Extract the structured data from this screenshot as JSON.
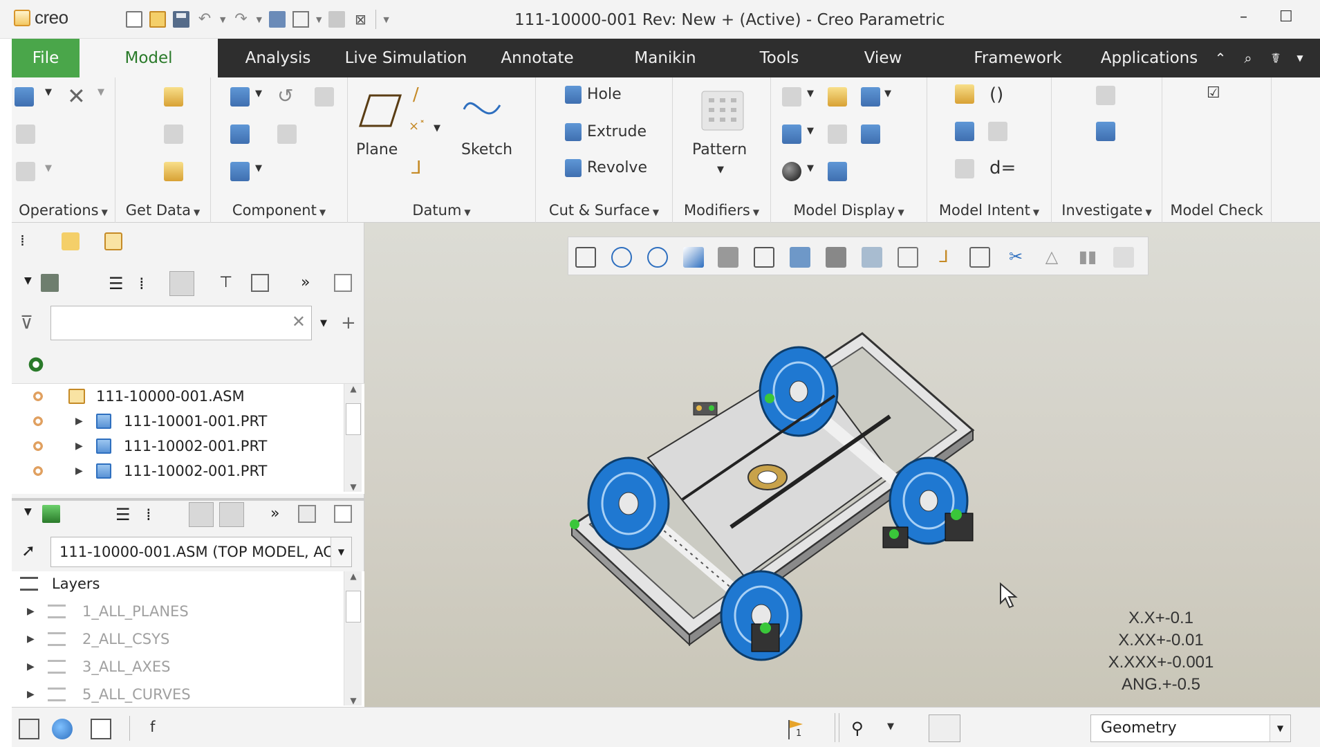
{
  "app": {
    "logo_text": "creo",
    "window_title": "111-10000-001 Rev: New + (Active) - Creo Parametric"
  },
  "tabs": [
    {
      "label": "File"
    },
    {
      "label": "Model"
    },
    {
      "label": "Analysis"
    },
    {
      "label": "Live Simulation"
    },
    {
      "label": "Annotate"
    },
    {
      "label": "Manikin"
    },
    {
      "label": "Tools"
    },
    {
      "label": "View"
    },
    {
      "label": "Framework"
    },
    {
      "label": "Applications"
    }
  ],
  "ribbon": {
    "groups": [
      {
        "label": "Operations"
      },
      {
        "label": "Get Data"
      },
      {
        "label": "Component"
      },
      {
        "label": "Datum"
      },
      {
        "label": "Cut & Surface"
      },
      {
        "label": "Modifiers"
      },
      {
        "label": "Model Display"
      },
      {
        "label": "Model Intent"
      },
      {
        "label": "Investigate"
      },
      {
        "label": "Model Check"
      }
    ],
    "buttons": {
      "plane": "Plane",
      "sketch": "Sketch",
      "hole": "Hole",
      "extrude": "Extrude",
      "revolve": "Revolve",
      "pattern": "Pattern",
      "relations": "d="
    }
  },
  "model_tree": {
    "search_placeholder": "",
    "items": [
      {
        "label": "111-10000-001.ASM"
      },
      {
        "label": "111-10001-001.PRT"
      },
      {
        "label": "111-10002-001.PRT"
      },
      {
        "label": "111-10002-001.PRT"
      }
    ]
  },
  "layer_tree": {
    "model_select": "111-10000-001.ASM (TOP MODEL, AC",
    "header": "Layers",
    "items": [
      {
        "label": "1_ALL_PLANES"
      },
      {
        "label": "2_ALL_CSYS"
      },
      {
        "label": "3_ALL_AXES"
      },
      {
        "label": "5_ALL_CURVES"
      }
    ]
  },
  "viewport": {
    "tolerances": [
      "X.X+-0.1",
      "X.XX+-0.01",
      "X.XXX+-0.001",
      "ANG.+-0.5"
    ]
  },
  "statusbar": {
    "message": "f",
    "filter_value": "Geometry",
    "flag_count": "1"
  },
  "colors": {
    "file_tab": "#4aa64a",
    "tab_bar": "#2e2e2e",
    "wheel_blue": "#1f78d1",
    "model_green": "#2a7a2a"
  }
}
